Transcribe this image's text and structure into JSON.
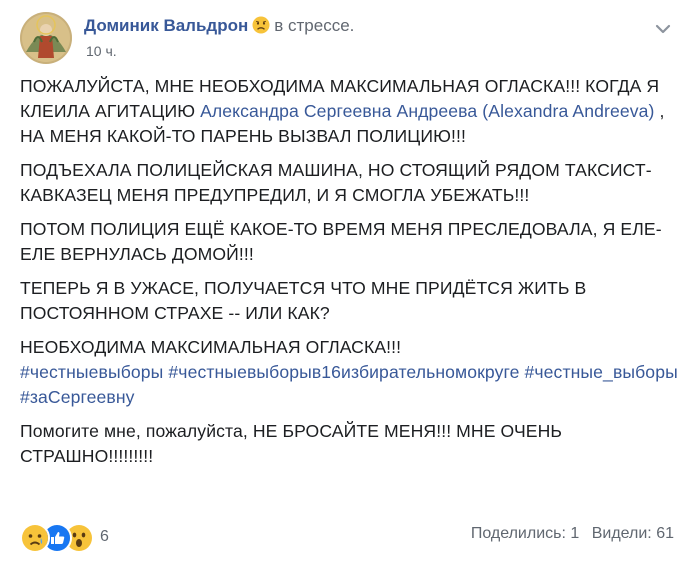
{
  "post": {
    "author": "Доминик Вальдрон",
    "feeling": "в стрессе.",
    "timestamp": "10 ч.",
    "paragraphs": {
      "p1_a": "ПОЖАЛУЙСТА, МНЕ НЕОБХОДИМА МАКСИМАЛЬНАЯ ОГЛАСКА!!! КОГДА Я КЛЕИЛА АГИТАЦИЮ ",
      "p1_link": "Александра Сергеевна Андреева (Alexandra Andreeva)",
      "p1_b": " , НА МЕНЯ КАКОЙ-ТО ПАРЕНЬ ВЫЗВАЛ ПОЛИЦИЮ!!!",
      "p2": "ПОДЪЕХАЛА ПОЛИЦЕЙСКАЯ МАШИНА, НО СТОЯЩИЙ РЯДОМ ТАКСИСТ-КАВКАЗЕЦ МЕНЯ ПРЕДУПРЕДИЛ, И Я СМОГЛА УБЕЖАТЬ!!!",
      "p3": "ПОТОМ ПОЛИЦИЯ ЕЩЁ КАКОЕ-ТО ВРЕМЯ МЕНЯ ПРЕСЛЕДОВАЛА, Я ЕЛЕ-ЕЛЕ ВЕРНУЛАСЬ ДОМОЙ!!!",
      "p4": "ТЕПЕРЬ Я В УЖАСЕ, ПОЛУЧАЕТСЯ ЧТО МНЕ ПРИДЁТСЯ ЖИТЬ В ПОСТОЯННОМ СТРАХЕ -- ИЛИ КАК?",
      "p5": "НЕОБХОДИМА МАКСИМАЛЬНАЯ ОГЛАСКА!!!",
      "p6": "Помогите мне, пожалуйста, НЕ БРОСАЙТЕ МЕНЯ!!! МНЕ ОЧЕНЬ СТРАШНО!!!!!!!!!"
    },
    "hashtags": [
      "#честныевыборы",
      "#честныевыборыв16избирательномокруге",
      "#честные_выборы",
      "#заСергеевну"
    ]
  },
  "footer": {
    "reaction_icons": [
      "sad-reaction-icon",
      "like-reaction-icon",
      "wow-reaction-icon"
    ],
    "reaction_count": "6",
    "shares": "Поделились: 1",
    "views": "Видели: 61"
  },
  "colors": {
    "link": "#385898",
    "text": "#1c1e21",
    "meta": "#606770",
    "like": "#1877f2",
    "emoji": "#f7c33a"
  }
}
